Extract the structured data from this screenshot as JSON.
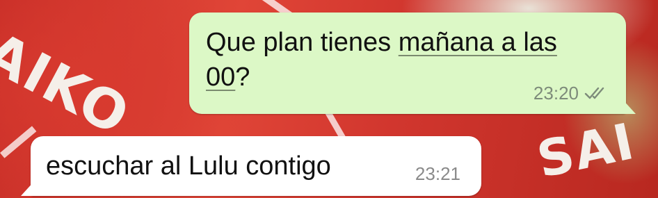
{
  "wallpaper": {
    "jersey_text_left": "AIKO",
    "jersey_text_right": "SAI"
  },
  "messages": [
    {
      "direction": "outgoing",
      "text_before_link": "Que plan tienes ",
      "link_part_1": "mañana a las",
      "link_part_2": "00",
      "text_after_link": "?",
      "time": "23:20",
      "status": "read-double-check-icon"
    },
    {
      "direction": "incoming",
      "text": "escuchar al Lulu contigo",
      "time": "23:21"
    }
  ],
  "colors": {
    "outgoing_bubble": "#dcf8c6",
    "incoming_bubble": "#ffffff",
    "timestamp": "#7d8b7a"
  }
}
